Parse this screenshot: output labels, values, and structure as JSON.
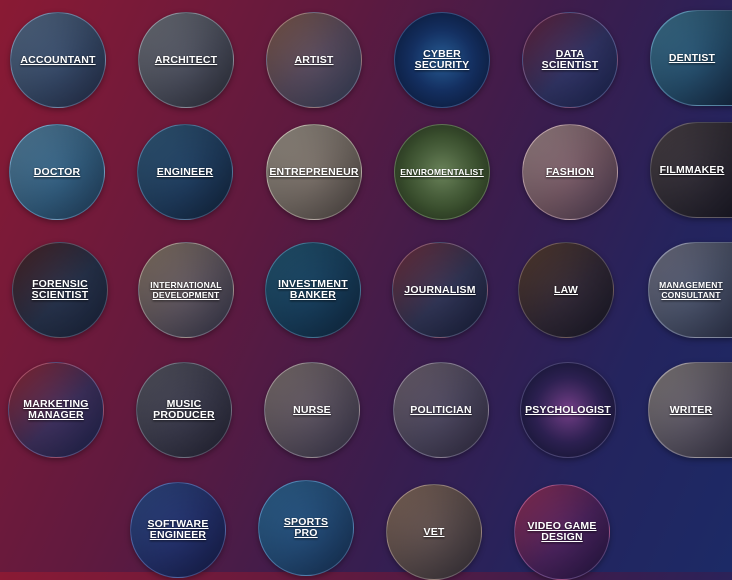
{
  "careers": {
    "accountant": "ACCOUNTANT",
    "architect": "ARCHITECT",
    "artist": "ARTIST",
    "cyber_security": "CYBER\nSECURITY",
    "data_scientist": "DATA\nSCIENTIST",
    "dentist": "DENTIST",
    "doctor": "DOCTOR",
    "engineer": "ENGINEER",
    "entrepreneur": "ENTREPRENEUR",
    "enviromentalist": "ENVIROMENTALIST",
    "fashion": "FASHION",
    "filmmaker": "FILMMAKER",
    "forensic_scientist": "FORENSIC\nSCIENTIST",
    "international_development": "INTERNATIONAL\nDEVELOPMENT",
    "investment_banker": "INVESTMENT\nBANKER",
    "journalism": "JOURNALISM",
    "law": "LAW",
    "management_consultant": "MANAGEMENT\nCONSULTANT",
    "marketing_manager": "MARKETING\nMANAGER",
    "music_producer": "MUSIC\nPRODUCER",
    "nurse": "NURSE",
    "politician": "POLITICIAN",
    "psychologist": "PSYCHOLOGIST",
    "writer": "WRITER",
    "software_engineer": "SOFTWARE\nENGINEER",
    "sports_pro": "SPORTS\nPRO",
    "vet": "VET",
    "video_game_design": "VIDEO GAME\nDESIGN"
  },
  "colors": {
    "background_start": "#8a1a34",
    "background_end": "#1c2a66",
    "label_text": "#ffffff"
  }
}
